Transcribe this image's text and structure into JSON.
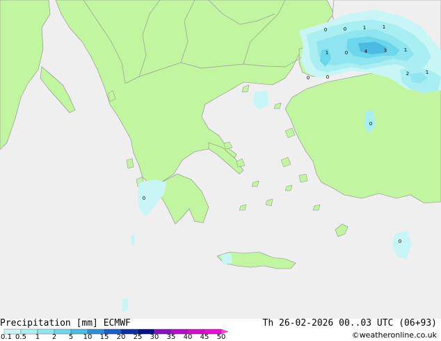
{
  "title": "Precipitation [mm]",
  "model": "ECMWF",
  "datetime": "Th 26-02-2026 00..03 UTC (06+93)",
  "credit": "©weatheronline.co.uk",
  "legend": {
    "ticks": [
      "0.1",
      "0.5",
      "1",
      "2",
      "5",
      "10",
      "15",
      "20",
      "25",
      "30",
      "35",
      "40",
      "45",
      "50"
    ],
    "colors": [
      "#c8f5f5",
      "#a8eef2",
      "#8ee4ef",
      "#6cd6ea",
      "#4bbbe3",
      "#2e8ed8",
      "#1760cc",
      "#0b2fa8",
      "#03128a",
      "#8a10c8",
      "#b80ccc",
      "#d80ad0",
      "#f00ad8",
      "#ff40e8"
    ]
  },
  "colors": {
    "land": "#c2f5a0",
    "sea": "#efefef",
    "border": "#9a9a9a",
    "coast": "#8a8a8a"
  },
  "map_labels": [
    {
      "text": "0"
    },
    {
      "text": "0"
    },
    {
      "text": "1"
    },
    {
      "text": "1"
    },
    {
      "text": "1"
    },
    {
      "text": "0"
    },
    {
      "text": "4"
    },
    {
      "text": "3"
    },
    {
      "text": "1"
    },
    {
      "text": "2"
    },
    {
      "text": "1"
    },
    {
      "text": "0"
    },
    {
      "text": "0"
    },
    {
      "text": "0"
    },
    {
      "text": "0"
    },
    {
      "text": "0"
    }
  ]
}
